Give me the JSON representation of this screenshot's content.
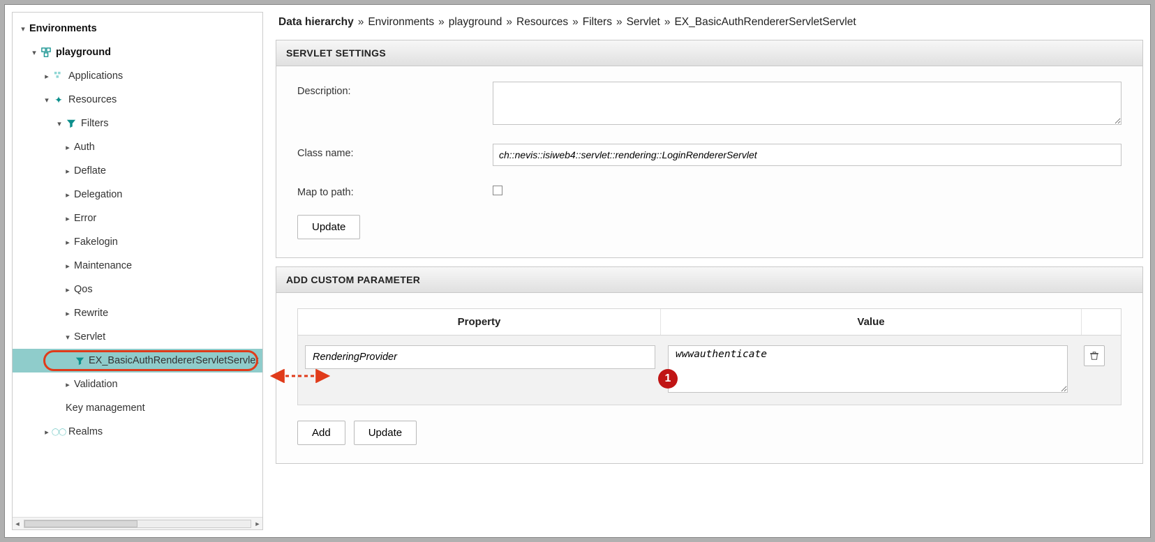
{
  "sidebar": {
    "root": "Environments",
    "playground": "playground",
    "items": {
      "applications": "Applications",
      "resources": "Resources",
      "filters": "Filters",
      "auth": "Auth",
      "deflate": "Deflate",
      "delegation": "Delegation",
      "error": "Error",
      "fakelogin": "Fakelogin",
      "maintenance": "Maintenance",
      "qos": "Qos",
      "rewrite": "Rewrite",
      "servlet": "Servlet",
      "ex_basic": "EX_BasicAuthRendererServletServlet",
      "validation": "Validation",
      "keymgmt": "Key management",
      "realms": "Realms"
    }
  },
  "breadcrumb": [
    {
      "label": "Data hierarchy",
      "bold": true
    },
    {
      "label": "Environments"
    },
    {
      "label": "playground"
    },
    {
      "label": "Resources"
    },
    {
      "label": "Filters"
    },
    {
      "label": "Servlet"
    },
    {
      "label": "EX_BasicAuthRendererServletServlet"
    }
  ],
  "sep": "»",
  "panels": {
    "settings": {
      "title": "SERVLET SETTINGS",
      "description_label": "Description:",
      "description_value": "",
      "classname_label": "Class name:",
      "classname_value": "ch::nevis::isiweb4::servlet::rendering::LoginRendererServlet",
      "maptopath_label": "Map to path:",
      "maptopath_checked": false,
      "update_btn": "Update"
    },
    "custom": {
      "title": "ADD CUSTOM PARAMETER",
      "head_property": "Property",
      "head_value": "Value",
      "row": {
        "property": "RenderingProvider",
        "value": "wwwauthenticate"
      },
      "badge": "1",
      "add_btn": "Add",
      "update_btn": "Update"
    }
  }
}
